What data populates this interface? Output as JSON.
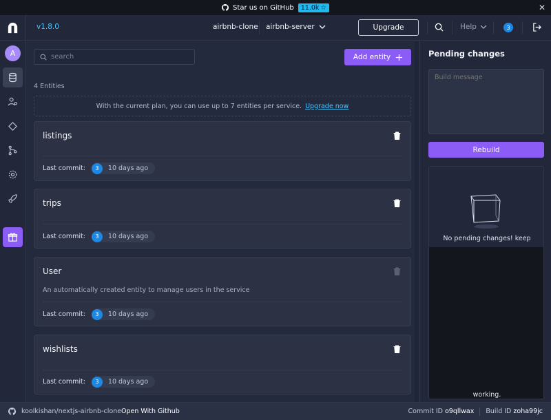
{
  "banner": {
    "text": "Star us on GitHub",
    "stars": "11.0k",
    "star_icon": "star-icon",
    "close": "✕"
  },
  "header": {
    "version": "v1.8.0",
    "project": "airbnb-clone",
    "service": "airbnb-server",
    "upgrade_label": "Upgrade",
    "help_label": "Help",
    "notifications": "3"
  },
  "sidebar": {
    "avatar_initial": "A",
    "items": [
      {
        "name": "entities",
        "icon": "database-icon",
        "active": true
      },
      {
        "name": "roles",
        "icon": "user-roles-icon",
        "active": false
      },
      {
        "name": "plugins",
        "icon": "diamond-icon",
        "active": false
      },
      {
        "name": "sync",
        "icon": "git-branch-icon",
        "active": false
      },
      {
        "name": "settings",
        "icon": "gear-icon",
        "active": false
      },
      {
        "name": "deploy",
        "icon": "rocket-icon",
        "active": false
      },
      {
        "name": "whats-new",
        "icon": "gift-icon",
        "active": false
      }
    ]
  },
  "main": {
    "search_placeholder": "search",
    "add_entity_label": "Add entity",
    "entity_count": "4 Entities",
    "plan_notice": "With the current plan, you can use up to 7 entities per service.",
    "plan_link": "Upgrade now",
    "entities": [
      {
        "name": "listings",
        "description": "",
        "commit_label": "Last commit:",
        "commit_user": "3",
        "commit_time": "10 days ago",
        "deletable": true
      },
      {
        "name": "trips",
        "description": "",
        "commit_label": "Last commit:",
        "commit_user": "3",
        "commit_time": "10 days ago",
        "deletable": true
      },
      {
        "name": "User",
        "description": "An automatically created entity to manage users in the service",
        "commit_label": "Last commit:",
        "commit_user": "3",
        "commit_time": "10 days ago",
        "deletable": false
      },
      {
        "name": "wishlists",
        "description": "",
        "commit_label": "Last commit:",
        "commit_user": "3",
        "commit_time": "10 days ago",
        "deletable": true
      }
    ]
  },
  "panel": {
    "title": "Pending changes",
    "build_placeholder": "Build message",
    "rebuild_label": "Rebuild",
    "empty_text": "No pending changes! keep",
    "working_text": "working."
  },
  "footer": {
    "repo": "koolkishan/nextjs-airbnb-clone",
    "open_label": "Open With Github",
    "commit_label": "Commit ID",
    "commit_id": "o9qllwax",
    "build_label": "Build ID",
    "build_id": "zoha99jc"
  },
  "colors": {
    "accent": "#8b5cf6",
    "link": "#4fc3f7",
    "badge": "#1e88e5",
    "background": "#22283a"
  }
}
